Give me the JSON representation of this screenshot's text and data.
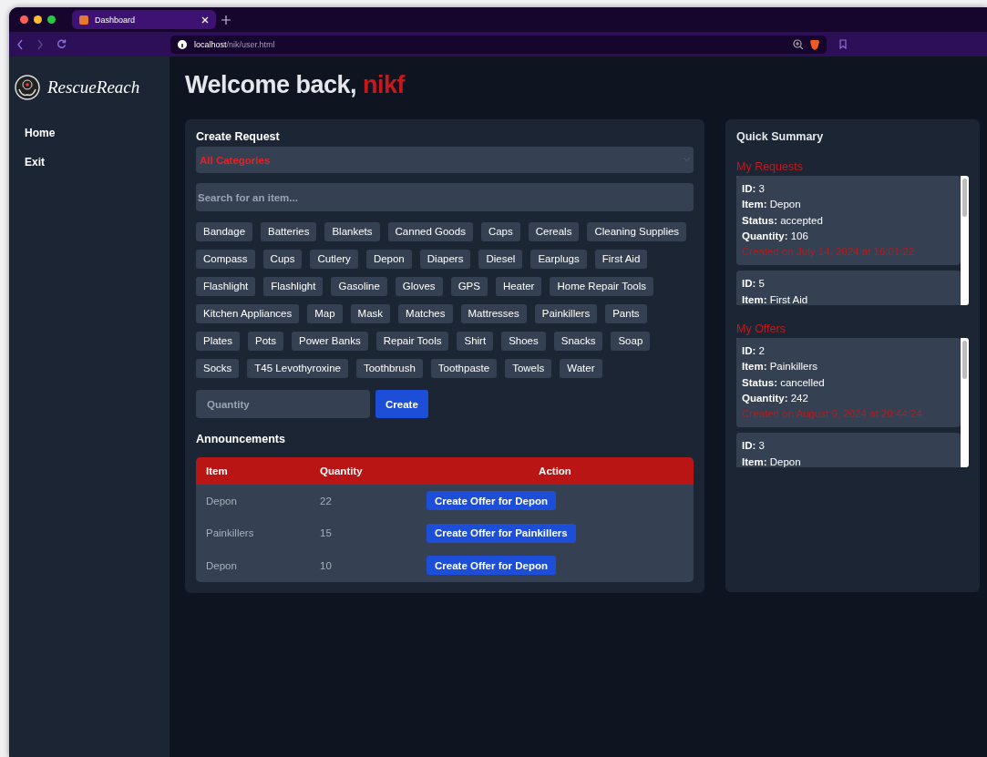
{
  "browser": {
    "tab_title": "Dashboard",
    "url_host": "localhost",
    "url_path": "/nik/user.html"
  },
  "sidebar": {
    "brand": "RescueReach",
    "items": [
      {
        "label": "Home"
      },
      {
        "label": "Exit"
      }
    ]
  },
  "greeting": {
    "text": "Welcome back,",
    "username": "nikf"
  },
  "create_request": {
    "title": "Create Request",
    "category": "All Categories",
    "search": {
      "placeholder": "Search for an item..."
    },
    "items": [
      "Bandage",
      "Batteries",
      "Blankets",
      "Canned Goods",
      "Caps",
      "Cereals",
      "Cleaning Supplies",
      "Compass",
      "Cups",
      "Cutlery",
      "Depon",
      "Diapers",
      "Diesel",
      "Earplugs",
      "First Aid",
      "Flashlight",
      "Flashlight",
      "Gasoline",
      "Gloves",
      "GPS",
      "Heater",
      "Home Repair Tools",
      "Kitchen Appliances",
      "Map",
      "Mask",
      "Matches",
      "Mattresses",
      "Painkillers",
      "Pants",
      "Plates",
      "Pots",
      "Power Banks",
      "Repair Tools",
      "Shirt",
      "Shoes",
      "Snacks",
      "Soap",
      "Socks",
      "T45 Levothyroxine",
      "Toothbrush",
      "Toothpaste",
      "Towels",
      "Water"
    ],
    "quantity": {
      "placeholder": "Quantity"
    },
    "create_button": "Create"
  },
  "announcements": {
    "title": "Announcements",
    "columns": [
      "Item",
      "Quantity",
      "Action"
    ],
    "rows": [
      {
        "item": "Depon",
        "quantity": "22",
        "action": "Create Offer for Depon"
      },
      {
        "item": "Painkillers",
        "quantity": "15",
        "action": "Create Offer for Painkillers"
      },
      {
        "item": "Depon",
        "quantity": "10",
        "action": "Create Offer for Depon"
      }
    ]
  },
  "summary": {
    "title": "Quick Summary",
    "sections": [
      {
        "title": "My Requests",
        "cards": [
          {
            "lines": [
              "**ID:** 3",
              "**Item:** Depon",
              "**Status:** accepted",
              "**Quantity:** 106"
            ],
            "created": "Created on July 14, 2024 at 16:01:22"
          },
          {
            "lines": [
              "**ID:** 5",
              "**Item:** First Aid"
            ]
          }
        ]
      },
      {
        "title": "My Offers",
        "cards": [
          {
            "lines": [
              "**ID:** 2",
              "**Item:** Painkillers",
              "**Status:** cancelled",
              "**Quantity:** 242"
            ],
            "created": "Created on August 9, 2024 at 20:44:24"
          },
          {
            "lines": [
              "**ID:** 3",
              "**Item:** Depon"
            ]
          }
        ]
      }
    ]
  }
}
